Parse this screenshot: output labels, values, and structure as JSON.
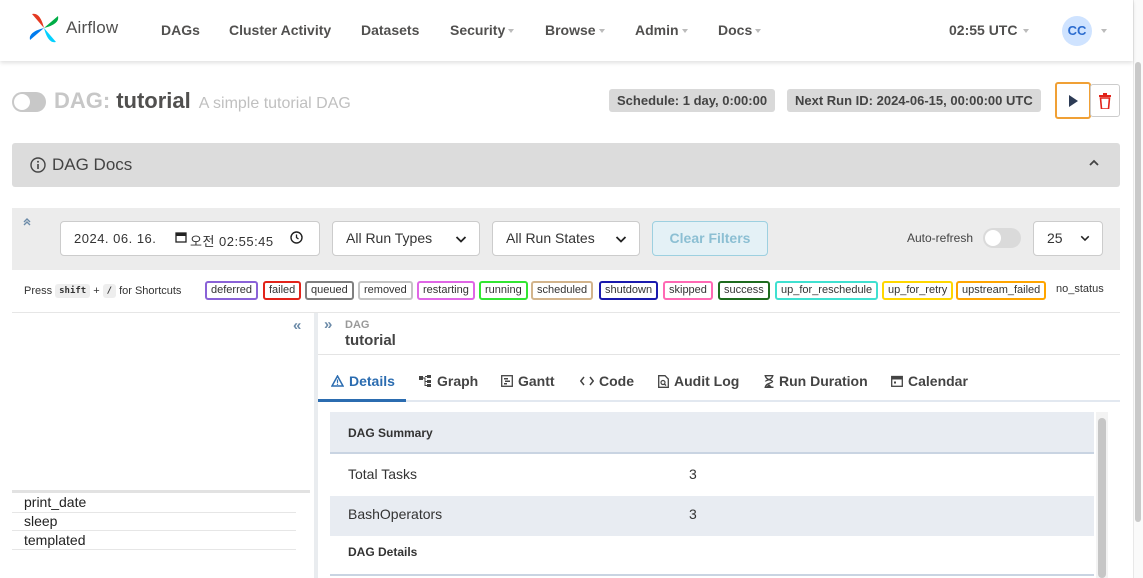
{
  "nav": {
    "brand": "Airflow",
    "items": [
      {
        "label": "DAGs",
        "dropdown": false
      },
      {
        "label": "Cluster Activity",
        "dropdown": false
      },
      {
        "label": "Datasets",
        "dropdown": false
      },
      {
        "label": "Security",
        "dropdown": true
      },
      {
        "label": "Browse",
        "dropdown": true
      },
      {
        "label": "Admin",
        "dropdown": true
      },
      {
        "label": "Docs",
        "dropdown": true
      }
    ],
    "time": "02:55 UTC",
    "user_initials": "CC"
  },
  "dag": {
    "prefix": "DAG:",
    "name": "tutorial",
    "description": "A simple tutorial DAG",
    "schedule": "Schedule: 1 day, 0:00:00",
    "next_run": "Next Run ID: 2024-06-15, 00:00:00 UTC"
  },
  "docs": {
    "title": "DAG Docs"
  },
  "filters": {
    "date_value": "2024. 06. 16.",
    "time_value": "오전 02:55:45",
    "run_types": "All Run Types",
    "run_states": "All Run States",
    "clear_label": "Clear Filters",
    "auto_refresh_label": "Auto-refresh",
    "page_size": "25"
  },
  "shortcuts": {
    "press": "Press",
    "key1": "shift",
    "plus": "+",
    "key2": "/",
    "suffix": "for Shortcuts"
  },
  "states": [
    {
      "label": "deferred",
      "color": "#8a62d7"
    },
    {
      "label": "failed",
      "color": "#e2231a"
    },
    {
      "label": "queued",
      "color": "#808080"
    },
    {
      "label": "removed",
      "color": "#c4c4c4"
    },
    {
      "label": "restarting",
      "color": "#e066e6"
    },
    {
      "label": "running",
      "color": "#32e632"
    },
    {
      "label": "scheduled",
      "color": "#d2b48c"
    },
    {
      "label": "shutdown",
      "color": "#1a1aad"
    },
    {
      "label": "skipped",
      "color": "#ff69b4"
    },
    {
      "label": "success",
      "color": "#1e6b1e"
    },
    {
      "label": "up_for_reschedule",
      "color": "#40e0d0"
    },
    {
      "label": "up_for_retry",
      "color": "#ffd700"
    },
    {
      "label": "upstream_failed",
      "color": "#ffa500"
    },
    {
      "label": "no_status",
      "color": null
    }
  ],
  "tasks": [
    "print_date",
    "sleep",
    "templated"
  ],
  "breadcrumb": {
    "label": "DAG",
    "name": "tutorial"
  },
  "tabs": [
    {
      "label": "Details",
      "icon": "warning-triangle-icon"
    },
    {
      "label": "Graph",
      "icon": "graph-icon"
    },
    {
      "label": "Gantt",
      "icon": "gantt-icon"
    },
    {
      "label": "Code",
      "icon": "code-icon"
    },
    {
      "label": "Audit Log",
      "icon": "audit-log-icon"
    },
    {
      "label": "Run Duration",
      "icon": "hourglass-icon"
    },
    {
      "label": "Calendar",
      "icon": "calendar-icon"
    }
  ],
  "summary": {
    "heading": "DAG Summary",
    "rows": [
      {
        "key": "Total Tasks",
        "value": "3"
      },
      {
        "key": "BashOperators",
        "value": "3"
      }
    ],
    "details_heading": "DAG Details"
  },
  "colors": {
    "accent": "#2b6cb0",
    "trigger_border": "#f0a035",
    "delete_red": "#e2231a"
  }
}
